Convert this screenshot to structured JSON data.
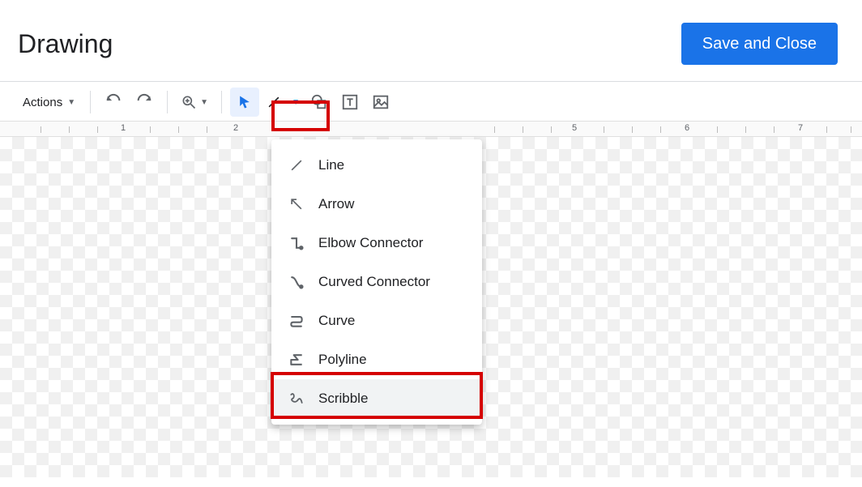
{
  "header": {
    "title": "Drawing",
    "save_label": "Save and Close"
  },
  "toolbar": {
    "actions_label": "Actions"
  },
  "ruler": {
    "numbers": [
      "1",
      "2",
      "5",
      "6",
      "7"
    ]
  },
  "line_menu": {
    "items": [
      {
        "label": "Line",
        "icon": "line-icon"
      },
      {
        "label": "Arrow",
        "icon": "arrow-icon"
      },
      {
        "label": "Elbow Connector",
        "icon": "elbow-icon"
      },
      {
        "label": "Curved Connector",
        "icon": "curved-connector-icon"
      },
      {
        "label": "Curve",
        "icon": "curve-icon"
      },
      {
        "label": "Polyline",
        "icon": "polyline-icon"
      },
      {
        "label": "Scribble",
        "icon": "scribble-icon"
      }
    ]
  }
}
